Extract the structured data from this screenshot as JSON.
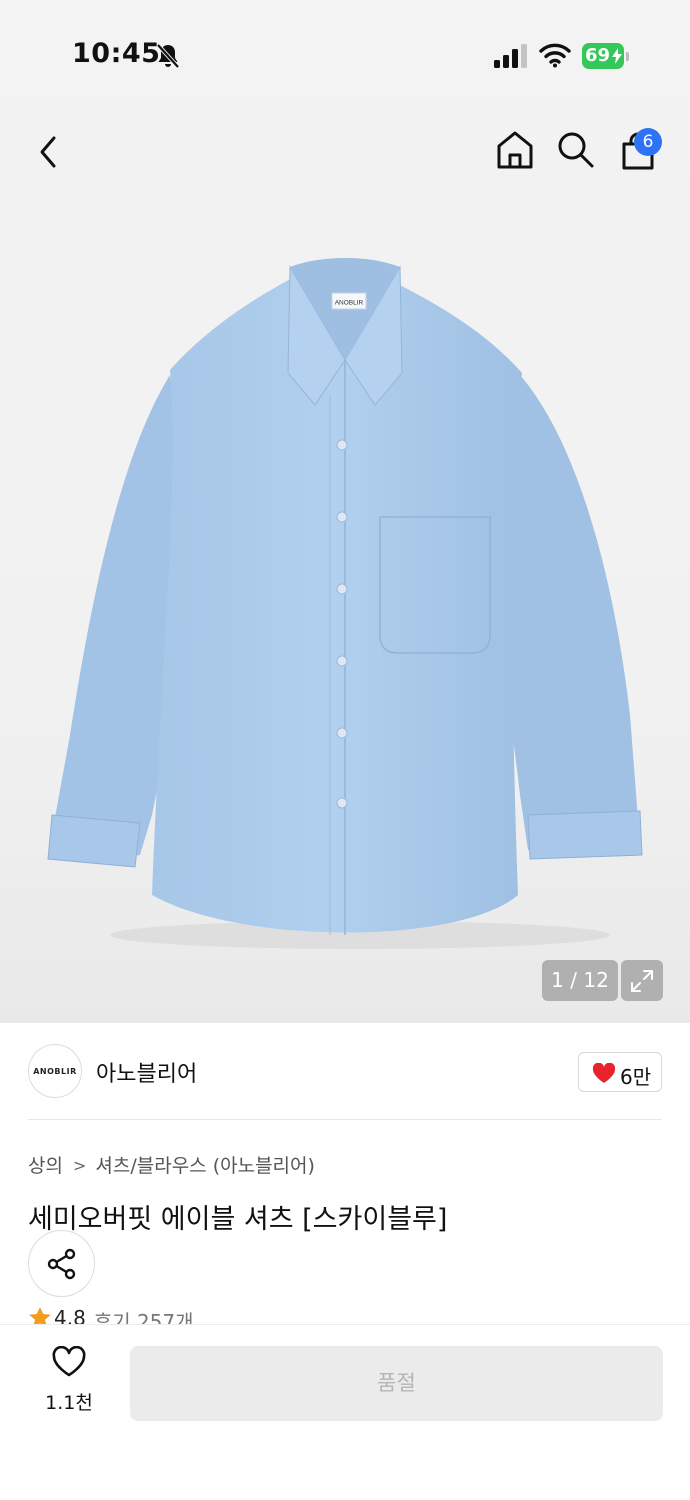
{
  "status_bar": {
    "time": "10:45",
    "battery": "69",
    "icons": [
      "bell-slash-icon",
      "cellular-signal-icon",
      "wifi-icon",
      "battery-charging-icon"
    ]
  },
  "nav": {
    "icons": [
      "chevron-left-icon",
      "home-icon",
      "search-icon",
      "shopping-bag-icon"
    ],
    "cart_badge": "6"
  },
  "gallery": {
    "counter": "1 / 12",
    "shirt_color": "#a9c9ea",
    "shirt_label": "ANOBLIR"
  },
  "brand": {
    "logo_text": "ANOBLIR",
    "name": "아노블리어",
    "likes": "6만"
  },
  "product": {
    "breadcrumb": [
      "상의",
      "셔츠/블라우스 (아노블리어)"
    ],
    "title": "세미오버핏 에이블 셔츠 [스카이블루]",
    "rating": "4.8",
    "reviews": "후기 257개"
  },
  "bottom_bar": {
    "wish_count": "1.1천",
    "buy_label": "품절"
  },
  "colors": {
    "accent_blue": "#2f73f5",
    "heart_red": "#e8232b",
    "battery_green": "#34c759",
    "star_orange": "#f29b1d"
  }
}
